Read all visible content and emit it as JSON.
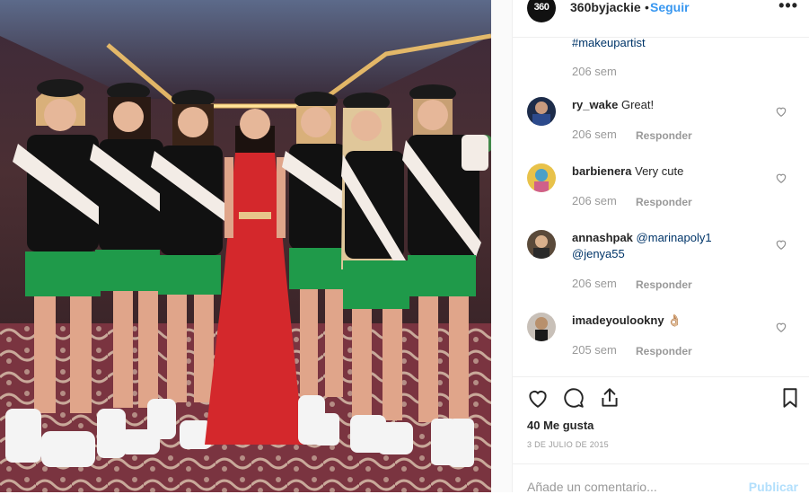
{
  "post": {
    "username": "360byjackie",
    "dot": "•",
    "follow_label": "Seguir",
    "more_icon": "•••",
    "avatar_text": "360",
    "caption_hashtag": "#makeupartist",
    "caption_time": "206 sem"
  },
  "comments": [
    {
      "user": "ry_wake",
      "text": "Great!",
      "time": "206 sem",
      "reply": "Responder"
    },
    {
      "user": "barbienera",
      "text": "Very cute",
      "time": "206 sem",
      "reply": "Responder"
    },
    {
      "user": "annashpak",
      "mention1": "@marinapoly1",
      "mention2": "@jenya55",
      "time": "206 sem",
      "reply": "Responder"
    },
    {
      "user": "imadeyoulookny",
      "text": "👌🏼",
      "time": "205 sem",
      "reply": "Responder"
    }
  ],
  "footer": {
    "likes": "40 Me gusta",
    "date": "3 DE JULIO DE 2015",
    "add_comment_placeholder": "Añade un comentario...",
    "publish_label": "Publicar"
  },
  "colors": {
    "link_blue": "#3897f0",
    "hashtag_blue": "#003569",
    "muted": "#999999",
    "publish_disabled": "#b2dffc",
    "dress_red": "#d4282c",
    "shorts_green": "#1f9a4a"
  },
  "icons": [
    "heart-icon",
    "comment-icon",
    "share-icon",
    "bookmark-icon",
    "more-options-icon"
  ]
}
